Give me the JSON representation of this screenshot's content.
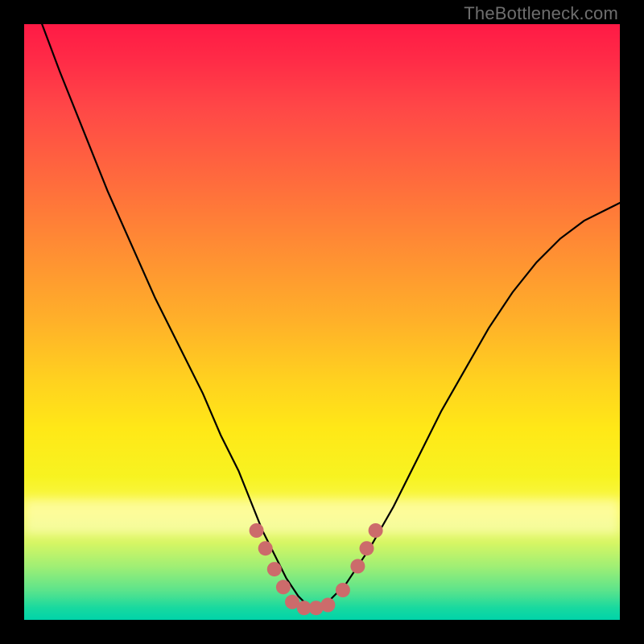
{
  "watermark": "TheBottleneck.com",
  "chart_data": {
    "type": "line",
    "title": "",
    "xlabel": "",
    "ylabel": "",
    "xlim": [
      0,
      100
    ],
    "ylim": [
      0,
      100
    ],
    "x": [
      3,
      6,
      10,
      14,
      18,
      22,
      26,
      30,
      33,
      36,
      38,
      40,
      42,
      44,
      46,
      48,
      50,
      54,
      58,
      62,
      66,
      70,
      74,
      78,
      82,
      86,
      90,
      94,
      98,
      100
    ],
    "y": [
      100,
      92,
      82,
      72,
      63,
      54,
      46,
      38,
      31,
      25,
      20,
      15,
      11,
      7,
      4,
      2,
      2,
      6,
      12,
      19,
      27,
      35,
      42,
      49,
      55,
      60,
      64,
      67,
      69,
      70
    ],
    "series": [
      {
        "name": "bottleneck-curve",
        "x": [
          3,
          6,
          10,
          14,
          18,
          22,
          26,
          30,
          33,
          36,
          38,
          40,
          42,
          44,
          46,
          48,
          50,
          54,
          58,
          62,
          66,
          70,
          74,
          78,
          82,
          86,
          90,
          94,
          98,
          100
        ],
        "y": [
          100,
          92,
          82,
          72,
          63,
          54,
          46,
          38,
          31,
          25,
          20,
          15,
          11,
          7,
          4,
          2,
          2,
          6,
          12,
          19,
          27,
          35,
          42,
          49,
          55,
          60,
          64,
          67,
          69,
          70
        ]
      }
    ],
    "markers": [
      {
        "x": 39,
        "y": 15
      },
      {
        "x": 40.5,
        "y": 12
      },
      {
        "x": 42,
        "y": 8.5
      },
      {
        "x": 43.5,
        "y": 5.5
      },
      {
        "x": 45,
        "y": 3
      },
      {
        "x": 47,
        "y": 2
      },
      {
        "x": 49,
        "y": 2
      },
      {
        "x": 51,
        "y": 2.5
      },
      {
        "x": 53.5,
        "y": 5
      },
      {
        "x": 56,
        "y": 9
      },
      {
        "x": 57.5,
        "y": 12
      },
      {
        "x": 59,
        "y": 15
      }
    ],
    "marker_radius_px": 9,
    "gradient_stops": [
      {
        "pos": 0,
        "color": "#ff1a45"
      },
      {
        "pos": 50,
        "color": "#ffb129"
      },
      {
        "pos": 76,
        "color": "#f7f321"
      },
      {
        "pos": 100,
        "color": "#00d3a9"
      }
    ]
  }
}
